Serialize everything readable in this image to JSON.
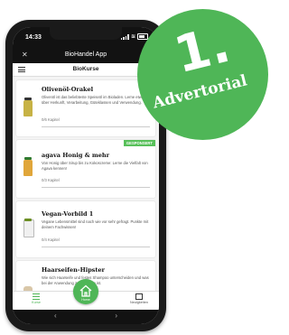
{
  "status": {
    "time": "14:33"
  },
  "app": {
    "title": "BioHandel App",
    "close_icon": "close-icon"
  },
  "section": {
    "title": "BioKurse",
    "menu_icon": "hamburger-icon"
  },
  "courses": [
    {
      "title": "Olivenöl-Orakel",
      "description": "Olivenöl ist das beliebteste Speiseöl im Bioladen. Lerne etwas über Herkunft, Verarbeitung, Güteklassen und Verwendung.",
      "progress": "0/6 Kapitel",
      "sponsored": ""
    },
    {
      "title": "agava Honig & mehr",
      "description": "Von Honig über Sirup bis zu Kokoscreme: Lerne die Vielfalt von Agava kennen!",
      "progress": "0/3 Kapitel",
      "sponsored": "GESPONSERT"
    },
    {
      "title": "Vegan-Vorbild 1",
      "description": "Vegane Lebensmittel sind nach wie vor sehr gefragt. Punkte mit deinem Fachwissen!",
      "progress": "0/4 Kapitel",
      "sponsored": ""
    },
    {
      "title": "Haarseifen-Hipster",
      "description": "Wie sich Haarseife und festes Shampoo unterscheiden und was bei der Anwendung zu beachten ist.",
      "progress": "",
      "sponsored": ""
    }
  ],
  "nav": {
    "left_label": "Kurse",
    "home_label": "Home",
    "right_label": "Neuigkeiten"
  },
  "advertorial": {
    "number": "1.",
    "label": "Advertorial"
  },
  "colors": {
    "accent": "#4fb657",
    "badge": "#58c05a"
  }
}
